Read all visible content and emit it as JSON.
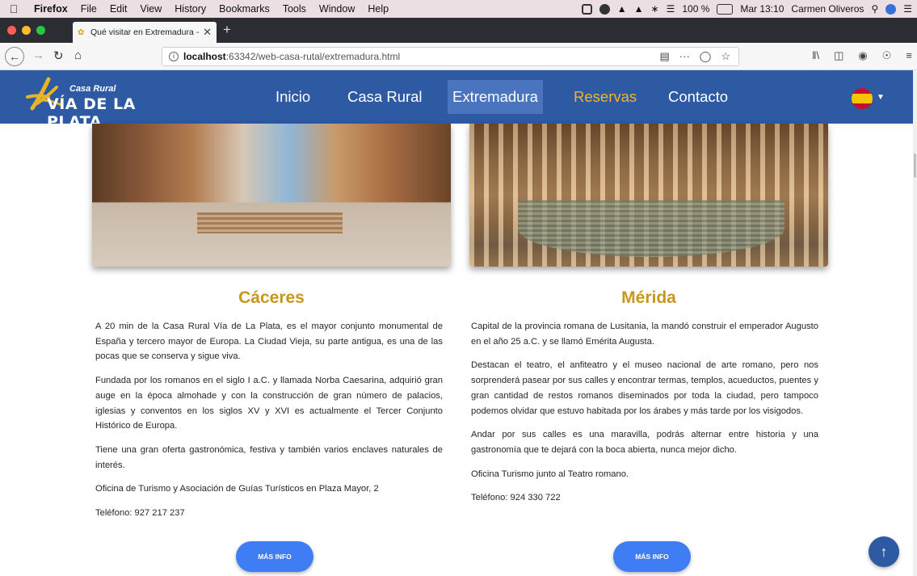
{
  "macos": {
    "app_name": "Firefox",
    "menus": [
      "File",
      "Edit",
      "View",
      "History",
      "Bookmarks",
      "Tools",
      "Window",
      "Help"
    ],
    "battery": "100 %",
    "clock": "Mar 13:10",
    "user": "Carmen Oliveros"
  },
  "browser": {
    "tab_title": "Qué visitar en Extremadura - C",
    "url_host": "localhost",
    "url_rest": ":63342/web-casa-rutal/extremadura.html",
    "overflow_glyph": "···"
  },
  "site": {
    "logo_line1": "Casa Rural",
    "logo_line2": "VÍA DE LA PLATA",
    "nav": {
      "inicio": "Inicio",
      "casa_rural": "Casa Rural",
      "extremadura": "Extremadura",
      "reservas": "Reservas",
      "contacto": "Contacto"
    },
    "colors": {
      "navbar": "#2e5aa3",
      "title_gold": "#c8961c",
      "reservas": "#f5b323",
      "button": "#3f7df5"
    }
  },
  "caceres": {
    "title": "Cáceres",
    "paragraphs": [
      "A 20 min de la Casa Rural Vía de La Plata, es el mayor conjunto monumental de España y tercero mayor de Europa. La Ciudad Vieja, su parte antigua, es una de las pocas que se conserva y sigue viva.",
      "Fundada por los romanos en el siglo I a.C. y llamada Norba Caesarina, adquirió gran auge en la época almohade y con la construcción de gran número de palacios, iglesias y conventos en los siglos XV y XVI es actualmente el Tercer Conjunto Histórico de Europa.",
      "Tiene una gran oferta gastronómica, festiva y también varios enclaves naturales de interés.",
      "Oficina de Turismo y Asociación de Guías Turísticos en Plaza Mayor, 2",
      "Teléfono: 927 217 237"
    ],
    "button": "MÁS INFO"
  },
  "merida": {
    "title": "Mérida",
    "paragraphs": [
      "Capital de la provincia romana de Lusitania, la mandó construir el emperador Augusto en el año 25 a.C. y se llamó Emérita Augusta.",
      "Destacan el teatro, el anfiteatro y el museo nacional de arte romano, pero nos sorprenderá pasear por sus calles y encontrar termas, templos, acueductos, puentes y gran cantidad de restos romanos diseminados por toda la ciudad, pero tampoco podemos olvidar que estuvo habitada por los árabes y más tarde por los visigodos.",
      "Andar por sus calles es una maravilla, podrás alternar entre historia y una gastronomía que te dejará con la boca abierta, nunca mejor dicho.",
      "Oficina Turismo junto al Teatro romano.",
      "Teléfono: 924 330 722"
    ],
    "button": "MÁS INFO"
  }
}
